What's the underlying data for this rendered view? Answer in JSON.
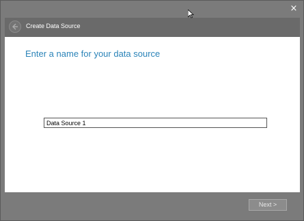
{
  "window": {
    "close_glyph": "×"
  },
  "header": {
    "title": "Create Data Source",
    "back_icon": "back-arrow-icon"
  },
  "content": {
    "prompt": "Enter a name for your data source",
    "name_input_value": "Data Source 1"
  },
  "footer": {
    "next_label": "Next >"
  },
  "colors": {
    "chrome": "#7b7b7b",
    "header": "#6a6a6a",
    "prompt_text": "#2a83b8",
    "content_bg": "#ffffff"
  }
}
